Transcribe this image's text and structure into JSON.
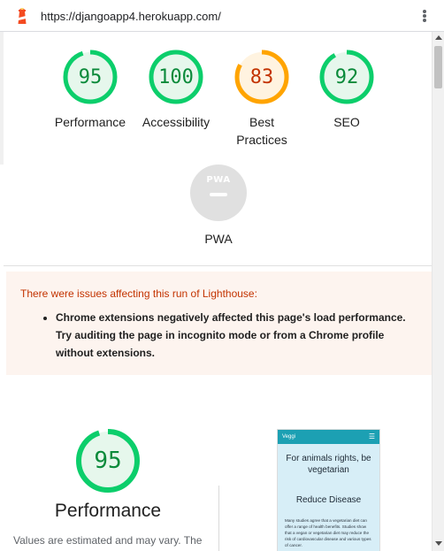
{
  "header": {
    "url": "https://djangoapp4.herokuapp.com/"
  },
  "gauges": [
    {
      "label": "Performance",
      "score": "95",
      "value": 95,
      "status": "pass"
    },
    {
      "label": "Accessibility",
      "score": "100",
      "value": 100,
      "status": "pass"
    },
    {
      "label": "Best Practices",
      "score": "83",
      "value": 83,
      "status": "average"
    },
    {
      "label": "SEO",
      "score": "92",
      "value": 92,
      "status": "pass"
    }
  ],
  "pwa": {
    "badge_text": "PWA",
    "label": "PWA"
  },
  "warning": {
    "title": "There were issues affecting this run of Lighthouse:",
    "items": [
      "Chrome extensions negatively affected this page's load performance. Try auditing the page in incognito mode or from a Chrome profile without extensions."
    ]
  },
  "performance": {
    "score": "95",
    "value": 95,
    "title": "Performance",
    "note": "Values are estimated and may vary. The"
  },
  "thumbnail": {
    "brand": "Veggi",
    "headline": "For animals rights, be vegetarian",
    "subheading": "Reduce Disease",
    "body": "Many studies agree that a vegetarian diet can offer a range of health benefits. Studies show that a vegan or vegetarian diet may reduce the risk of cardiovascular disease and various types of cancer."
  },
  "colors": {
    "pass": "#0cce6b",
    "pass_text": "#0a8a3a",
    "pass_fill": "#e6f7ec",
    "average": "#ffa400",
    "average_text": "#c33300",
    "average_fill": "#fff3e0",
    "warning_bg": "#fdf4ef"
  },
  "icons": {
    "logo": "lighthouse-logo-icon",
    "menu": "kebab-menu-icon"
  }
}
